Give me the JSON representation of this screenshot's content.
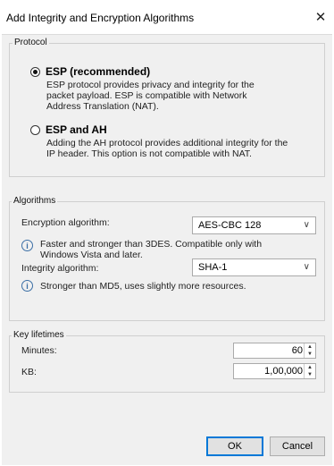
{
  "window": {
    "title": "Add Integrity and Encryption Algorithms",
    "close_icon": "close-icon"
  },
  "protocol": {
    "legend": "Protocol",
    "options": [
      {
        "label": "ESP (recommended)",
        "checked": true,
        "description": "ESP protocol provides privacy and integrity for the packet payload. ESP is compatible with Network Address Translation (NAT)."
      },
      {
        "label": "ESP and AH",
        "checked": false,
        "description": "Adding the AH protocol provides additional integrity for the IP header. This option is not compatible with NAT."
      }
    ]
  },
  "algorithms": {
    "legend": "Algorithms",
    "encryption": {
      "label": "Encryption algorithm:",
      "value": "AES-CBC 128",
      "info": "Faster and stronger than 3DES. Compatible only with Windows Vista and later."
    },
    "integrity": {
      "label": "Integrity algorithm:",
      "value": "SHA-1",
      "info": "Stronger than MD5, uses slightly more resources."
    }
  },
  "key_lifetimes": {
    "legend": "Key lifetimes",
    "minutes": {
      "label": "Minutes:",
      "value": "60"
    },
    "kb": {
      "label": "KB:",
      "value": "1,00,000"
    }
  },
  "buttons": {
    "ok": "OK",
    "cancel": "Cancel"
  }
}
